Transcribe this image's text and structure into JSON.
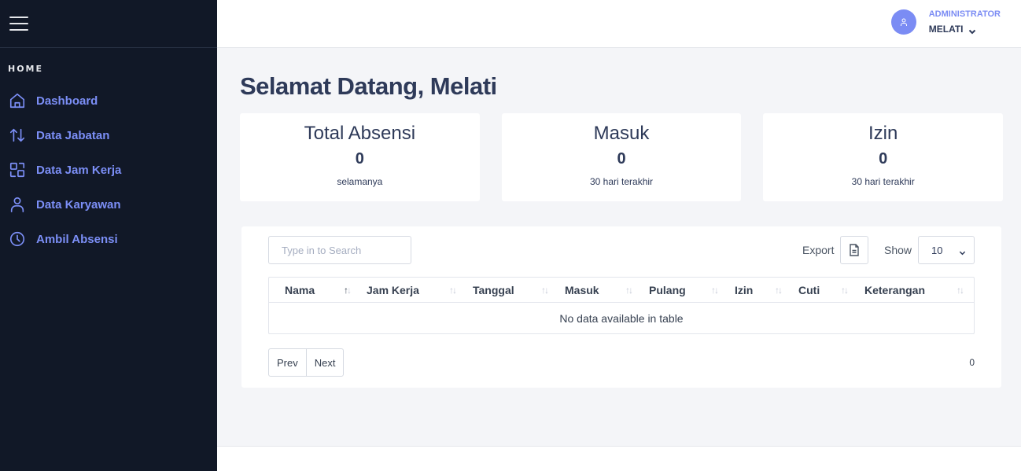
{
  "sidebar": {
    "section_label": "HOME",
    "items": [
      {
        "label": "Dashboard",
        "icon": "home-icon"
      },
      {
        "label": "Data Jabatan",
        "icon": "sort-arrows-icon"
      },
      {
        "label": "Data Jam Kerja",
        "icon": "shapes-icon"
      },
      {
        "label": "Data Karyawan",
        "icon": "user-icon"
      },
      {
        "label": "Ambil Absensi",
        "icon": "clock-icon"
      }
    ]
  },
  "header": {
    "user_role": "ADMINISTRATOR",
    "user_name": "MELATI"
  },
  "main": {
    "title": "Selamat Datang, Melati",
    "cards": [
      {
        "title": "Total Absensi",
        "value": "0",
        "subtitle": "selamanya"
      },
      {
        "title": "Masuk",
        "value": "0",
        "subtitle": "30 hari terakhir"
      },
      {
        "title": "Izin",
        "value": "0",
        "subtitle": "30 hari terakhir"
      }
    ]
  },
  "table_panel": {
    "search_placeholder": "Type in to Search",
    "export_label": "Export",
    "show_label": "Show",
    "show_value": "10",
    "columns": [
      "Nama",
      "Jam Kerja",
      "Tanggal",
      "Masuk",
      "Pulang",
      "Izin",
      "Cuti",
      "Keterangan"
    ],
    "sort_icon": "↑↓",
    "empty_message": "No data available in table",
    "prev_label": "Prev",
    "next_label": "Next",
    "total_count": "0"
  },
  "colors": {
    "sidebar_bg": "#111827",
    "accent": "#7b8cf4",
    "text_dark": "#2e3a59",
    "page_bg": "#f4f5f8"
  }
}
